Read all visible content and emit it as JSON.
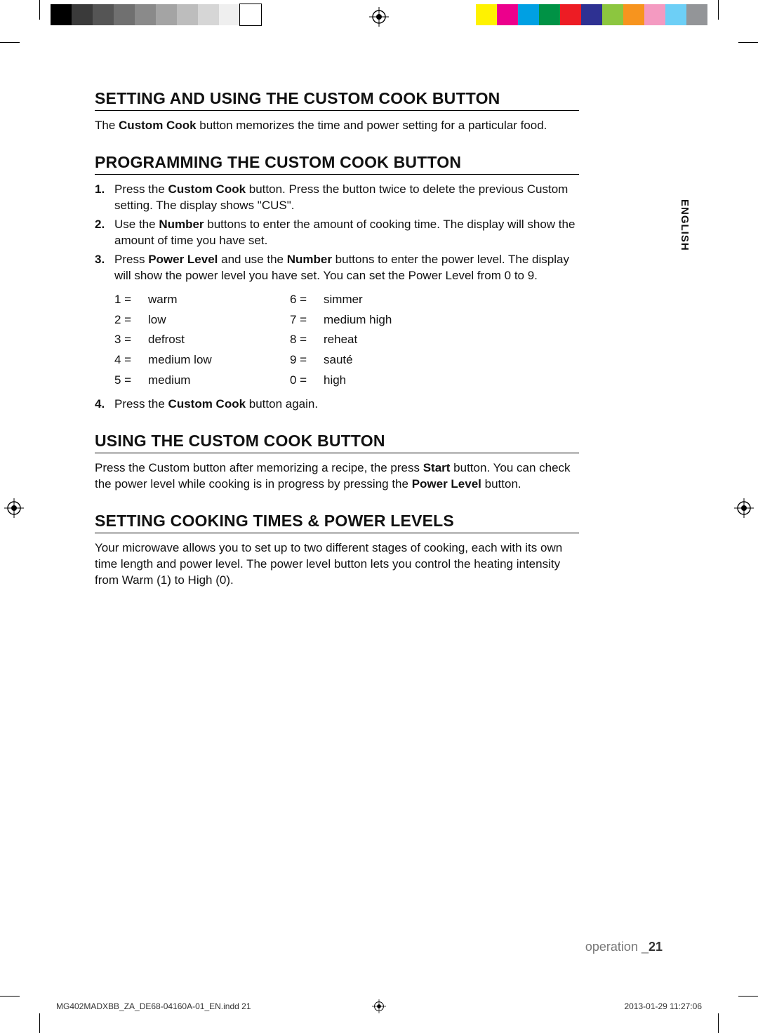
{
  "colorbar": {
    "left": [
      "#000000",
      "#3a3a3a",
      "#555555",
      "#707070",
      "#8a8a8a",
      "#a4a4a4",
      "#bdbdbd",
      "#d6d6d6",
      "#efefef",
      "#ffffff"
    ],
    "right": [
      "#fff200",
      "#ec008c",
      "#00a0e3",
      "#009245",
      "#ed1c24",
      "#2e3192",
      "#8cc63f",
      "#f7941e",
      "#f49ac1",
      "#6dcff6",
      "#939598"
    ]
  },
  "language_tab": "ENGLISH",
  "sections": {
    "s1": {
      "title": "SETTING AND USING THE CUSTOM COOK BUTTON",
      "para_pre": "The ",
      "para_strong": "Custom Cook",
      "para_post": " button memorizes the time and power setting for a particular food."
    },
    "s2": {
      "title": "PROGRAMMING THE CUSTOM COOK BUTTON",
      "steps": {
        "n1": "1.",
        "t1_a": "Press the ",
        "t1_b": "Custom Cook",
        "t1_c": " button. Press the button twice to delete the previous Custom setting. The display shows \"CUS\".",
        "n2": "2.",
        "t2_a": "Use the ",
        "t2_b": "Number",
        "t2_c": " buttons to enter the amount of cooking time. The display will show the amount of time you have set.",
        "n3": "3.",
        "t3_a": "Press ",
        "t3_b": "Power Level",
        "t3_c": " and use the ",
        "t3_d": "Number",
        "t3_e": " buttons to enter the power level. The display will show the power level you have set. You can set the Power Level from 0 to 9.",
        "n4": "4.",
        "t4_a": "Press the ",
        "t4_b": "Custom Cook",
        "t4_c": " button again."
      },
      "power_levels": {
        "k1": "1 =",
        "v1": "warm",
        "k6": "6 =",
        "v6": "simmer",
        "k2": "2 =",
        "v2": "low",
        "k7": "7 =",
        "v7": "medium high",
        "k3": "3 =",
        "v3": "defrost",
        "k8": "8 =",
        "v8": "reheat",
        "k4": "4 =",
        "v4": "medium low",
        "k9": "9 =",
        "v9": "sauté",
        "k5": "5 =",
        "v5": "medium",
        "k0": "0 =",
        "v0": "high"
      }
    },
    "s3": {
      "title": "USING THE CUSTOM COOK BUTTON",
      "p_a": "Press the Custom button after memorizing a recipe, the press ",
      "p_b": "Start",
      "p_c": " button. You can check the power level while cooking is in progress by pressing the ",
      "p_d": "Power Level",
      "p_e": " button."
    },
    "s4": {
      "title": "SETTING COOKING TIMES & POWER LEVELS",
      "para": "Your microwave allows you to set up to two different stages of cooking, each with its own time length and power level. The power level button lets you control the heating intensity from Warm (1) to High (0)."
    }
  },
  "footer": {
    "section": "operation _",
    "page": "21"
  },
  "imposition": {
    "file": "MG402MADXBB_ZA_DE68-04160A-01_EN.indd   21",
    "timestamp": "2013-01-29    11:27:06"
  }
}
